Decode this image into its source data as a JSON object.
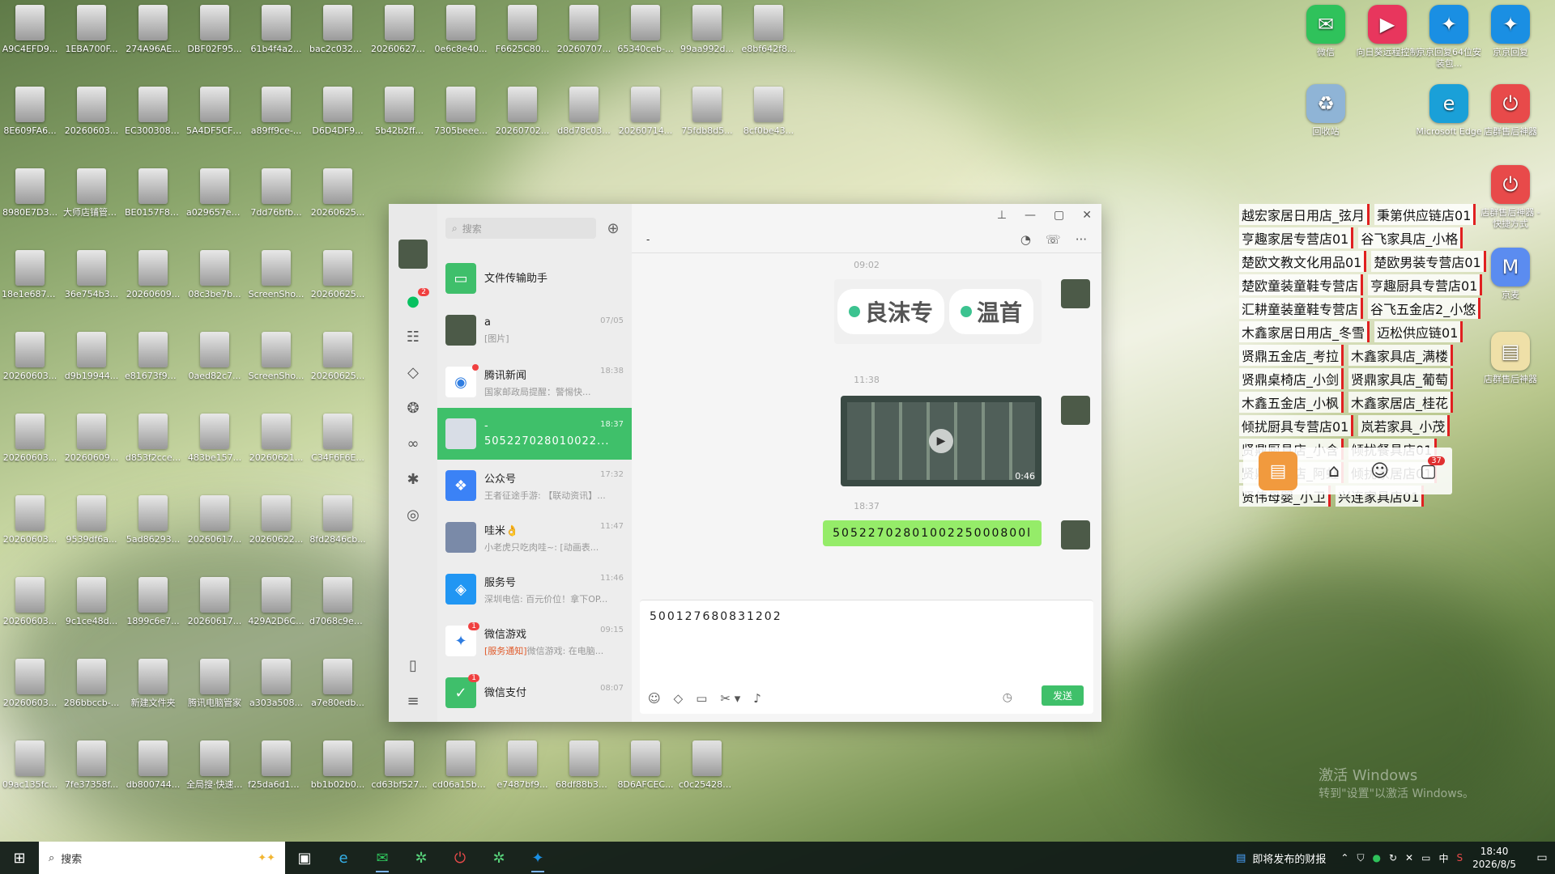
{
  "desktop": {
    "grid_icons": [
      {
        "label": "A9C4EFD9...",
        "col": 0,
        "row": 0
      },
      {
        "label": "1EBA700F...",
        "col": 1,
        "row": 0
      },
      {
        "label": "274A96AE...",
        "col": 2,
        "row": 0
      },
      {
        "label": "DBF02F95...",
        "col": 3,
        "row": 0
      },
      {
        "label": "61b4f4a2...",
        "col": 4,
        "row": 0
      },
      {
        "label": "bac2c032e...",
        "col": 5,
        "row": 0
      },
      {
        "label": "202606271...",
        "col": 6,
        "row": 0
      },
      {
        "label": "0e6c8e40...",
        "col": 7,
        "row": 0
      },
      {
        "label": "F6625C80...",
        "col": 8,
        "row": 0
      },
      {
        "label": "20260707...",
        "col": 9,
        "row": 0
      },
      {
        "label": "65340ceb-...",
        "col": 10,
        "row": 0
      },
      {
        "label": "99aa992d...",
        "col": 11,
        "row": 0
      },
      {
        "label": "e8bf642f8...",
        "col": 12,
        "row": 0
      },
      {
        "label": "8E609FA6...",
        "col": 0,
        "row": 1
      },
      {
        "label": "20260603...",
        "col": 1,
        "row": 1
      },
      {
        "label": "EC300308-...",
        "col": 2,
        "row": 1
      },
      {
        "label": "5A4DF5CF-...",
        "col": 3,
        "row": 1
      },
      {
        "label": "a89ff9ce-...",
        "col": 4,
        "row": 1
      },
      {
        "label": "D6D4DF9...",
        "col": 5,
        "row": 1
      },
      {
        "label": "5b42b2ff...",
        "col": 6,
        "row": 1
      },
      {
        "label": "7305beee...",
        "col": 7,
        "row": 1
      },
      {
        "label": "20260702...",
        "col": 8,
        "row": 1
      },
      {
        "label": "d8d78c03...",
        "col": 9,
        "row": 1
      },
      {
        "label": "20260714...",
        "col": 10,
        "row": 1
      },
      {
        "label": "75fdb8d5...",
        "col": 11,
        "row": 1
      },
      {
        "label": "8cf0be43...",
        "col": 12,
        "row": 1
      },
      {
        "label": "8980E7D3...",
        "col": 0,
        "row": 2
      },
      {
        "label": "大师店铺管理系统",
        "col": 1,
        "row": 2
      },
      {
        "label": "BE0157F8-...",
        "col": 2,
        "row": 2
      },
      {
        "label": "a029657ea...",
        "col": 3,
        "row": 2
      },
      {
        "label": "7dd76bfb...",
        "col": 4,
        "row": 2
      },
      {
        "label": "20260625...",
        "col": 5,
        "row": 2
      },
      {
        "label": "18e1e687c...",
        "col": 0,
        "row": 3
      },
      {
        "label": "36e754b3...",
        "col": 1,
        "row": 3
      },
      {
        "label": "20260609...",
        "col": 2,
        "row": 3
      },
      {
        "label": "08c3be7b...",
        "col": 3,
        "row": 3
      },
      {
        "label": "ScreenSho...",
        "col": 4,
        "row": 3
      },
      {
        "label": "20260625...",
        "col": 5,
        "row": 3
      },
      {
        "label": "20260603...",
        "col": 0,
        "row": 4
      },
      {
        "label": "d9b19944...",
        "col": 1,
        "row": 4
      },
      {
        "label": "e81673f92...",
        "col": 2,
        "row": 4
      },
      {
        "label": "0aed82c7...",
        "col": 3,
        "row": 4
      },
      {
        "label": "ScreenSho...",
        "col": 4,
        "row": 4
      },
      {
        "label": "20260625...",
        "col": 5,
        "row": 4
      },
      {
        "label": "20260603...",
        "col": 0,
        "row": 5
      },
      {
        "label": "20260609...",
        "col": 1,
        "row": 5
      },
      {
        "label": "d853f2cce...",
        "col": 2,
        "row": 5
      },
      {
        "label": "483be157...",
        "col": 3,
        "row": 5
      },
      {
        "label": "20260621...",
        "col": 4,
        "row": 5
      },
      {
        "label": "C34F6F6E...",
        "col": 5,
        "row": 5
      },
      {
        "label": "20260603...",
        "col": 0,
        "row": 6
      },
      {
        "label": "9539df6a...",
        "col": 1,
        "row": 6
      },
      {
        "label": "5ad86293...",
        "col": 2,
        "row": 6
      },
      {
        "label": "20260617...",
        "col": 3,
        "row": 6
      },
      {
        "label": "20260622...",
        "col": 4,
        "row": 6
      },
      {
        "label": "8fd2846cb...",
        "col": 5,
        "row": 6
      },
      {
        "label": "20260603...",
        "col": 0,
        "row": 7
      },
      {
        "label": "9c1ce48d...",
        "col": 1,
        "row": 7
      },
      {
        "label": "1899c6e7...",
        "col": 2,
        "row": 7
      },
      {
        "label": "20260617...",
        "col": 3,
        "row": 7
      },
      {
        "label": "429A2D6C...",
        "col": 4,
        "row": 7
      },
      {
        "label": "d7068c9e8...",
        "col": 5,
        "row": 7
      },
      {
        "label": "20260603...",
        "col": 0,
        "row": 8
      },
      {
        "label": "286bbccb-...",
        "col": 1,
        "row": 8
      },
      {
        "label": "新建文件夹",
        "col": 2,
        "row": 8
      },
      {
        "label": "腾讯电脑管家",
        "col": 3,
        "row": 8
      },
      {
        "label": "a303a508...",
        "col": 4,
        "row": 8
      },
      {
        "label": "a7e80edb...",
        "col": 5,
        "row": 8
      },
      {
        "label": "09ac135fc...",
        "col": 0,
        "row": 9
      },
      {
        "label": "7fe37358f...",
        "col": 1,
        "row": 9
      },
      {
        "label": "db800744...",
        "col": 2,
        "row": 9
      },
      {
        "label": "全局搜·快速启动器",
        "col": 3,
        "row": 9
      },
      {
        "label": "f25da6d16...",
        "col": 4,
        "row": 9
      },
      {
        "label": "bb1b02b0...",
        "col": 5,
        "row": 9
      },
      {
        "label": "cd63bf527...",
        "col": 6,
        "row": 9
      },
      {
        "label": "cd06a15b8...",
        "col": 7,
        "row": 9
      },
      {
        "label": "e7487bf9...",
        "col": 8,
        "row": 9
      },
      {
        "label": "68df88b34...",
        "col": 9,
        "row": 9
      },
      {
        "label": "8D6AFCEC...",
        "col": 10,
        "row": 9
      },
      {
        "label": "c0c254285...",
        "col": 11,
        "row": 9
      }
    ],
    "right_icons": [
      {
        "label": "微信",
        "glyph": "✉",
        "color": "#2fc25b"
      },
      {
        "label": "向日葵远程控制",
        "glyph": "▶",
        "color": "#e8365d"
      },
      {
        "label": "京京回复64位安装包...",
        "glyph": "✦",
        "color": "#1a8fe3"
      },
      {
        "label": "京京回复",
        "glyph": "✦",
        "color": "#1a8fe3"
      },
      {
        "label": "回收站",
        "glyph": "♻",
        "color": "#8fb4d6"
      },
      {
        "label": "Microsoft Edge",
        "glyph": "e",
        "color": "#1aa0d8"
      },
      {
        "label": "店群售后神器",
        "glyph": "⏻",
        "color": "#e84a4a"
      },
      {
        "label": "店群售后神器 - 快捷方式",
        "glyph": "⏻",
        "color": "#e84a4a"
      },
      {
        "label": "京麦",
        "glyph": "M",
        "color": "#5b8cf0"
      },
      {
        "label": "店群售后神器",
        "glyph": "▤",
        "color": "#efe0a8"
      }
    ],
    "watermark_line1": "激活 Windows",
    "watermark_line2": "转到\"设置\"以激活 Windows。"
  },
  "stores": [
    [
      "越宏家居日用店_弦月",
      "秉第供应链店01"
    ],
    [
      "亨趣家居专营店01",
      "谷飞家具店_小格"
    ],
    [
      "楚欧文教文化用品01",
      "楚欧男装专营店01"
    ],
    [
      "楚欧童装童鞋专营店",
      "亨趣厨具专营店01"
    ],
    [
      "汇耕童装童鞋专营店",
      "谷飞五金店2_小悠"
    ],
    [
      "木鑫家居日用店_冬雪",
      "迈松供应链01"
    ],
    [
      "贤鼎五金店_考拉",
      "木鑫家具店_满楼"
    ],
    [
      "贤鼎桌椅店_小剑",
      "贤鼎家具店_葡萄"
    ],
    [
      "木鑫五金店_小枫",
      "木鑫家居店_桂花"
    ],
    [
      "倾扰厨具专营店01",
      "岚若家具_小茂"
    ],
    [
      "贤鼎厨具店_小含",
      "倾扰餐具店01"
    ],
    [
      "贤鼎家居店_阿虹",
      "倾扰家居店01"
    ],
    [
      "贤伟母婴_小卫",
      "兴连家具店01"
    ]
  ],
  "shop_bar": {
    "badge": "37"
  },
  "wechat": {
    "rail": {
      "chat_badge": "2"
    },
    "search_placeholder": "搜索",
    "chat_title": "-",
    "conversations": [
      {
        "name": "文件传输助手",
        "time": "",
        "preview": "",
        "color": "#3fbf6b",
        "glyph": "▭"
      },
      {
        "name": "a",
        "time": "07/05",
        "preview": "[图片]",
        "color": "#4c5a48",
        "glyph": ""
      },
      {
        "name": "腾讯新闻",
        "time": "18:38",
        "preview": "国家邮政局提醒：警惕快...",
        "color": "#ffffff",
        "glyph": "◉",
        "dot": true
      },
      {
        "name": "-",
        "time": "18:37",
        "preview": "505227028010022...",
        "color": "#d8dde6",
        "glyph": "",
        "active": true
      },
      {
        "name": "公众号",
        "time": "17:32",
        "preview": "王者征途手游: 【联动资讯】...",
        "color": "#3b82f6",
        "glyph": "❖"
      },
      {
        "name": "哇米👌",
        "time": "11:47",
        "preview": "小老虎只吃肉哇~: [动画表...",
        "color": "#7a8aa8",
        "glyph": ""
      },
      {
        "name": "服务号",
        "time": "11:46",
        "preview": "深圳电信: 百元价位！拿下OP...",
        "color": "#2196f3",
        "glyph": "◈"
      },
      {
        "name": "微信游戏",
        "time": "09:15",
        "preview": "微信游戏: 在电脑...",
        "notice": "[服务通知]",
        "color": "#ffffff",
        "glyph": "✦",
        "badge": "1"
      },
      {
        "name": "微信支付",
        "time": "08:07",
        "preview": "",
        "color": "#3fbf6b",
        "glyph": "✓",
        "badge": "1"
      }
    ],
    "messages": {
      "ts1": "09:02",
      "pill1": "良沫专",
      "pill2": "温首",
      "ts2": "11:38",
      "video_duration": "0:46",
      "ts3": "18:37",
      "sent_text": "5052270280100225000800l"
    },
    "input_text": "500127680831202",
    "send_label": "发送"
  },
  "taskbar": {
    "search_placeholder": "搜索",
    "news_text": "即将发布的财报",
    "ime": "中",
    "time": "18:40",
    "date": "2026/8/5"
  }
}
